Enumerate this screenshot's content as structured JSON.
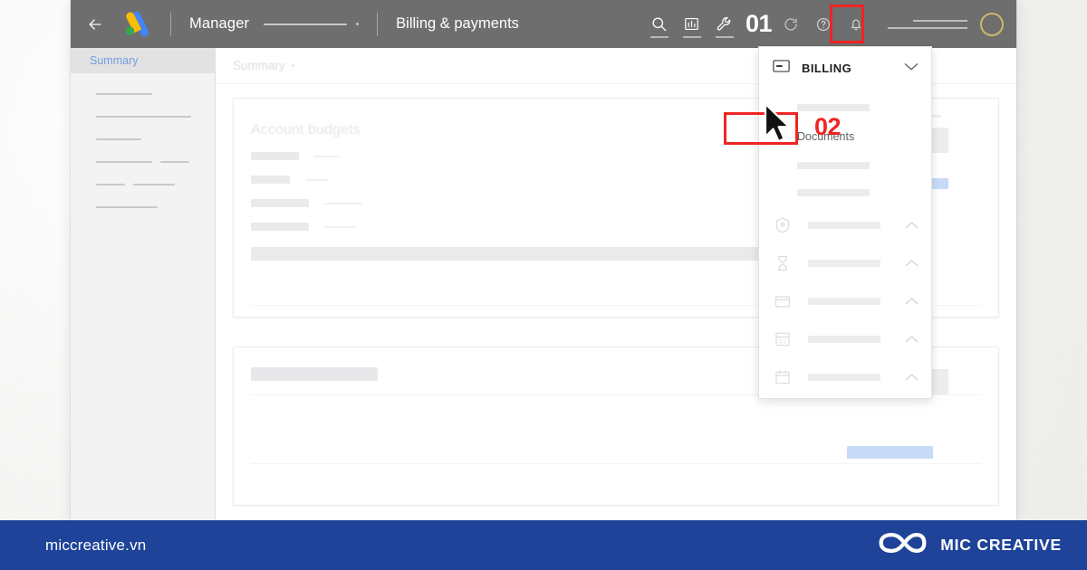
{
  "appbar": {
    "back_icon": "back-arrow-icon",
    "logo": "google-ads-logo",
    "account_name": "Manager",
    "page_title": "Billing & payments",
    "icons": [
      {
        "name": "search-icon",
        "glyph": "search"
      },
      {
        "name": "reports-icon",
        "glyph": "bar-chart"
      },
      {
        "name": "tools-icon",
        "glyph": "wrench"
      }
    ],
    "step_one_label": "01",
    "right_icons": [
      {
        "name": "refresh-icon",
        "glyph": "refresh"
      },
      {
        "name": "help-icon",
        "glyph": "question-circle"
      },
      {
        "name": "notifications-icon",
        "glyph": "bell"
      }
    ],
    "avatar": "avatar"
  },
  "sidebar": {
    "selected_item": "Summary",
    "placeholder_widths": [
      62,
      105,
      50,
      75,
      46,
      52,
      68,
      85
    ]
  },
  "content": {
    "breadcrumb": "Summary",
    "budgets_card_title": "Account budgets"
  },
  "dropdown": {
    "header_icon": "billing-card-icon",
    "header_label": "BILLING",
    "collapse_icon": "chevron-down-icon",
    "highlighted_item": "Documents",
    "step_two_label": "02",
    "section_icons": [
      "promotion-icon",
      "transactions-icon",
      "settings-icon",
      "billing-summary-icon",
      "payments-account-icon"
    ],
    "expand_icon": "chevron-up-icon"
  },
  "cursor": {
    "name": "mouse-pointer"
  },
  "footer": {
    "url": "miccreative.vn",
    "logo_icon": "mic-creative-infinity-logo",
    "brand": "MIC CREATIVE"
  },
  "colors": {
    "appbar_bg": "#6e6e6e",
    "highlight_red": "#ef2424",
    "footer_blue": "#1e4398",
    "accent_blue": "#6f9fe0",
    "placeholder_blue": "#c7dbf7"
  }
}
